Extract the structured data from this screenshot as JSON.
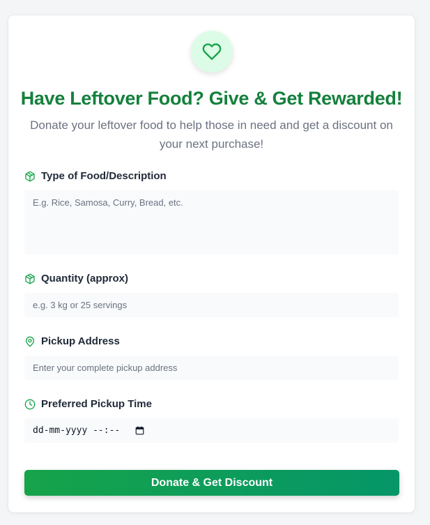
{
  "header": {
    "icon": "heart-icon",
    "title": "Have Leftover Food? Give & Get Rewarded!",
    "subtitle": "Donate your leftover food to help those in need and get a discount on your next purchase!"
  },
  "form": {
    "food": {
      "icon": "package-icon",
      "label": "Type of Food/Description",
      "placeholder": "E.g. Rice, Samosa, Curry, Bread, etc.",
      "value": ""
    },
    "quantity": {
      "icon": "package-icon",
      "label": "Quantity (approx)",
      "placeholder": "e.g. 3 kg or 25 servings",
      "value": ""
    },
    "address": {
      "icon": "map-pin-icon",
      "label": "Pickup Address",
      "placeholder": "Enter your complete pickup address",
      "value": ""
    },
    "time": {
      "icon": "clock-icon",
      "label": "Preferred Pickup Time",
      "display": "dd-mm-yyyy --:--",
      "picker_icon": "calendar-icon"
    },
    "submit_label": "Donate & Get Discount"
  },
  "colors": {
    "accent": "#15803d",
    "icon_bg": "#dcfce7",
    "button_start": "#16a34a",
    "button_end": "#059669",
    "field_bg": "#f8fafc"
  }
}
